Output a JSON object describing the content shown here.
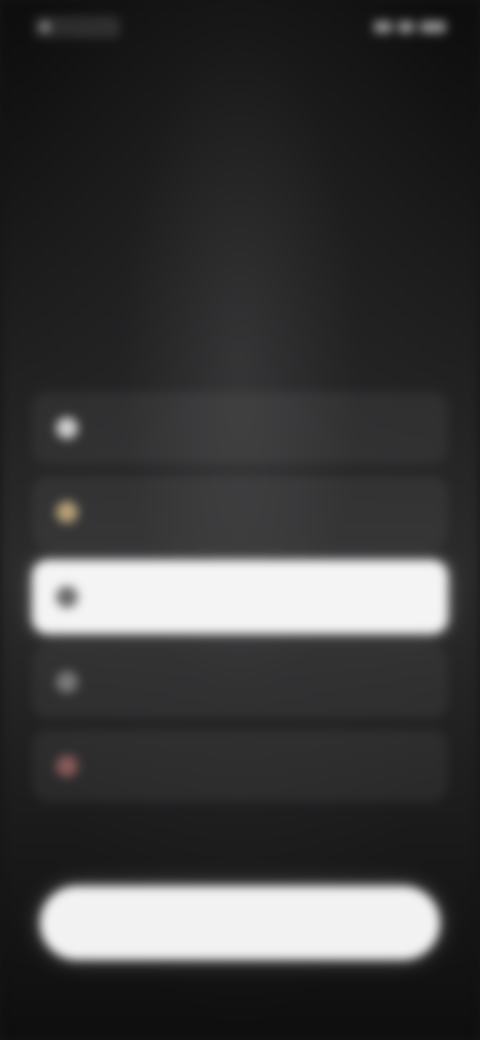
{
  "status_bar": {
    "time": "",
    "icons": [
      "signal-icon",
      "wifi-icon",
      "battery-icon"
    ]
  },
  "header": {
    "title": ""
  },
  "question": {
    "title": "",
    "subtitle": ""
  },
  "options": [
    {
      "label": "",
      "icon": "option-icon",
      "color": "#cfcfcf",
      "selected": false
    },
    {
      "label": "",
      "icon": "option-icon",
      "color": "#b8a37a",
      "selected": false
    },
    {
      "label": "",
      "icon": "option-icon",
      "color": "#6b6b6b",
      "selected": true
    },
    {
      "label": "",
      "icon": "option-icon",
      "color": "#7a7a7a",
      "selected": false
    },
    {
      "label": "",
      "icon": "option-icon",
      "color": "#8a5a5a",
      "selected": false
    }
  ],
  "primary_button": {
    "label": ""
  },
  "colors": {
    "background": "#151515",
    "selected_option": "#f4f4f4",
    "button": "#f2f2f2",
    "text_primary": "#f1f1f1",
    "text_secondary": "#9a9a9a"
  }
}
